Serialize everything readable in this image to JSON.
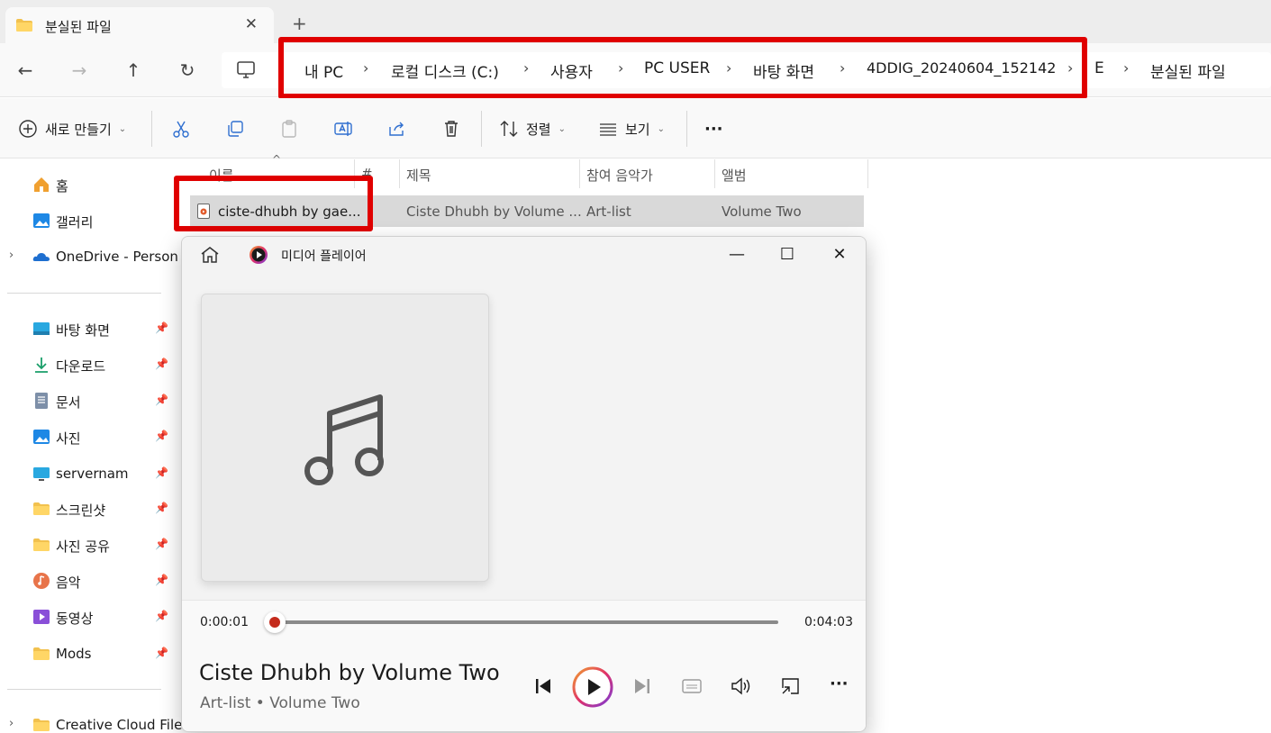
{
  "tab": {
    "title": "분실된 파일",
    "close": "✕",
    "new_tab": "+"
  },
  "nav": {
    "back": "←",
    "forward": "→",
    "up": "↑",
    "refresh": "↻",
    "breadcrumbs": [
      "내 PC",
      "로컬 디스크 (C:)",
      "사용자",
      "PC USER",
      "바탕 화면",
      "4DDIG_20240604_152142",
      "E",
      "분실된 파일"
    ],
    "separator": "›"
  },
  "toolbar": {
    "new_label": "새로 만들기",
    "sort_label": "정렬",
    "view_label": "보기",
    "more": "···"
  },
  "sidebar": {
    "items": [
      {
        "label": "홈",
        "icon": "home-icon"
      },
      {
        "label": "갤러리",
        "icon": "gallery-icon"
      },
      {
        "label": "OneDrive - Person",
        "icon": "onedrive-icon"
      },
      {
        "label": "바탕 화면",
        "icon": "desktop-icon"
      },
      {
        "label": "다운로드",
        "icon": "download-icon"
      },
      {
        "label": "문서",
        "icon": "document-icon"
      },
      {
        "label": "사진",
        "icon": "pictures-icon"
      },
      {
        "label": "servernam",
        "icon": "monitor-icon"
      },
      {
        "label": "스크린샷",
        "icon": "folder-icon"
      },
      {
        "label": "사진 공유",
        "icon": "folder-icon"
      },
      {
        "label": "음악",
        "icon": "music-icon"
      },
      {
        "label": "동영상",
        "icon": "video-icon"
      },
      {
        "label": "Mods",
        "icon": "folder-icon"
      },
      {
        "label": "Creative Cloud File",
        "icon": "folder-icon"
      }
    ],
    "pin": "📌"
  },
  "columns": {
    "name": "이름",
    "number": "#",
    "title": "제목",
    "artist": "참여 음악가",
    "album": "앨범"
  },
  "file": {
    "name": "ciste-dhubh by gae...",
    "title": "Ciste Dhubh by Volume ...",
    "artist": "Art-list",
    "album": "Volume Two"
  },
  "player": {
    "app_title": "미디어 플레이어",
    "elapsed": "0:00:01",
    "duration": "0:04:03",
    "progress": 0.004,
    "song_title": "Ciste Dhubh by Volume Two",
    "song_sub": "Art-list • Volume Two",
    "more": "···",
    "accent": "#c42b1c"
  }
}
